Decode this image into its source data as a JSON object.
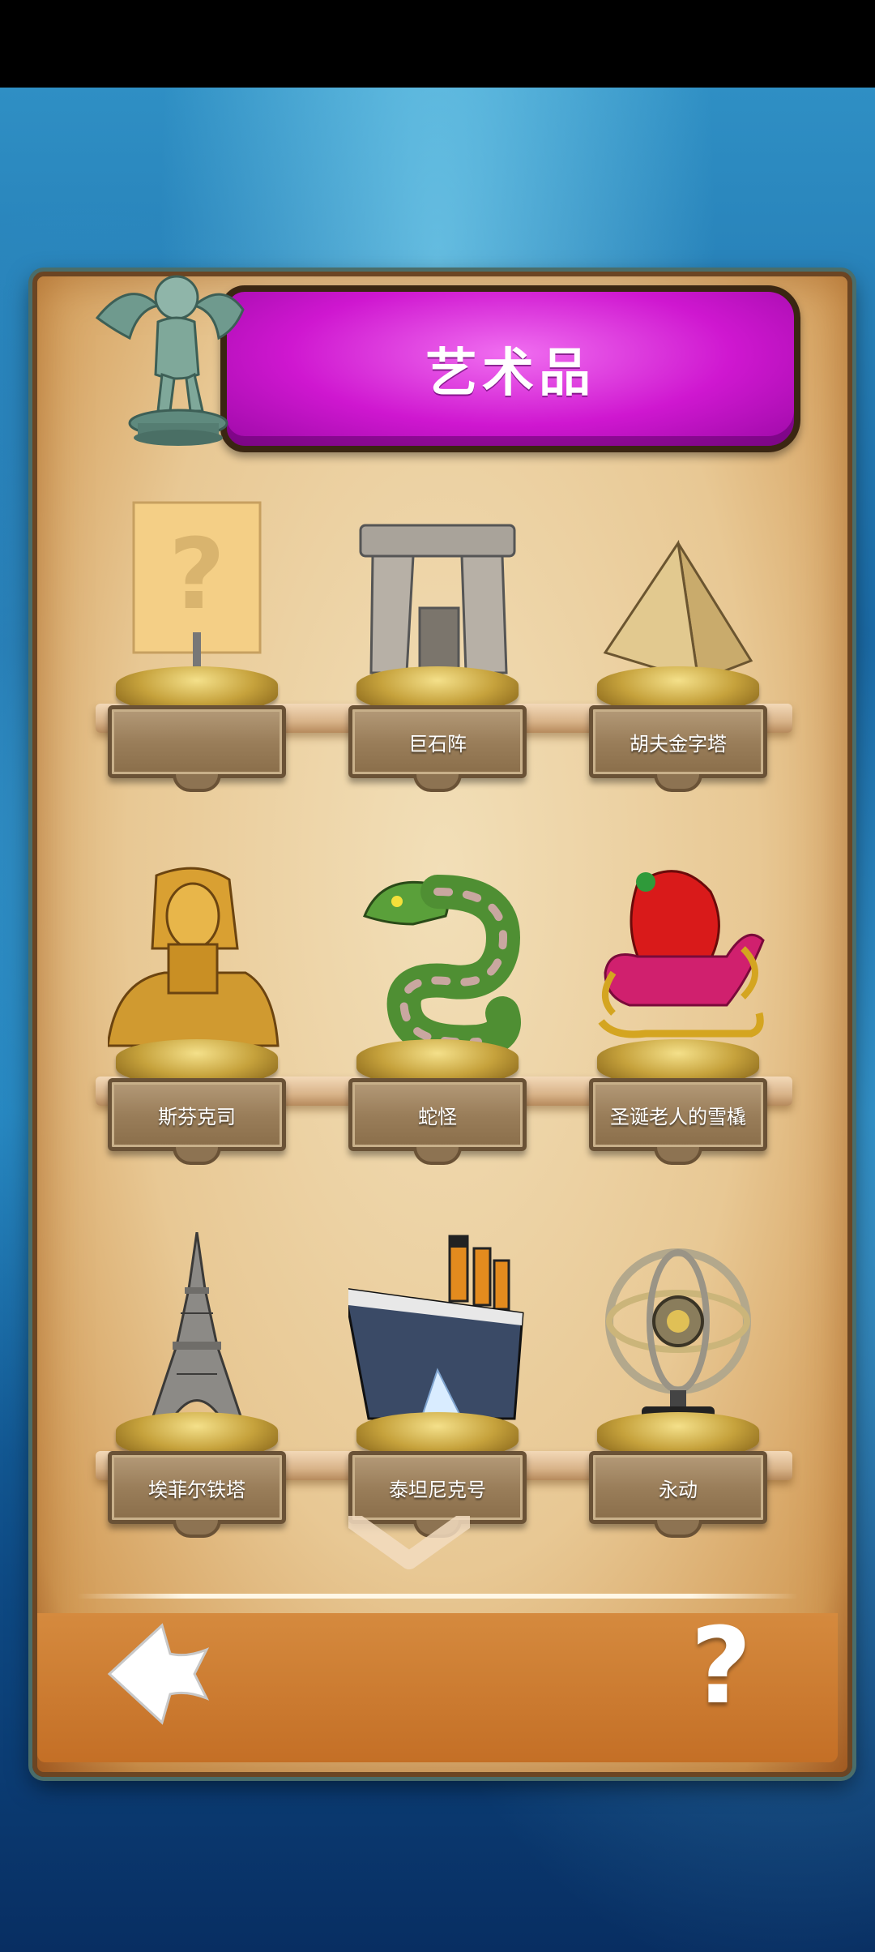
{
  "title": "艺术品",
  "artifacts": [
    {
      "name": "",
      "icon": "unknown-card-icon",
      "locked": true
    },
    {
      "name": "巨石阵",
      "icon": "stonehenge-icon"
    },
    {
      "name": "胡夫金字塔",
      "icon": "pyramid-icon"
    },
    {
      "name": "斯芬克司",
      "icon": "sphinx-icon"
    },
    {
      "name": "蛇怪",
      "icon": "serpent-icon"
    },
    {
      "name": "圣诞老人的雪橇",
      "icon": "santa-sleigh-icon"
    },
    {
      "name": "埃菲尔铁塔",
      "icon": "eiffel-tower-icon"
    },
    {
      "name": "泰坦尼克号",
      "icon": "titanic-icon"
    },
    {
      "name": "永动",
      "icon": "perpetual-motion-icon"
    }
  ],
  "buttons": {
    "help_label": "?",
    "back_icon": "back-arrow-icon",
    "scroll_icon": "chevron-down-icon"
  },
  "colors": {
    "banner": "#cf17d0",
    "panel": "#e8c894",
    "background": "#1a6aa6"
  }
}
